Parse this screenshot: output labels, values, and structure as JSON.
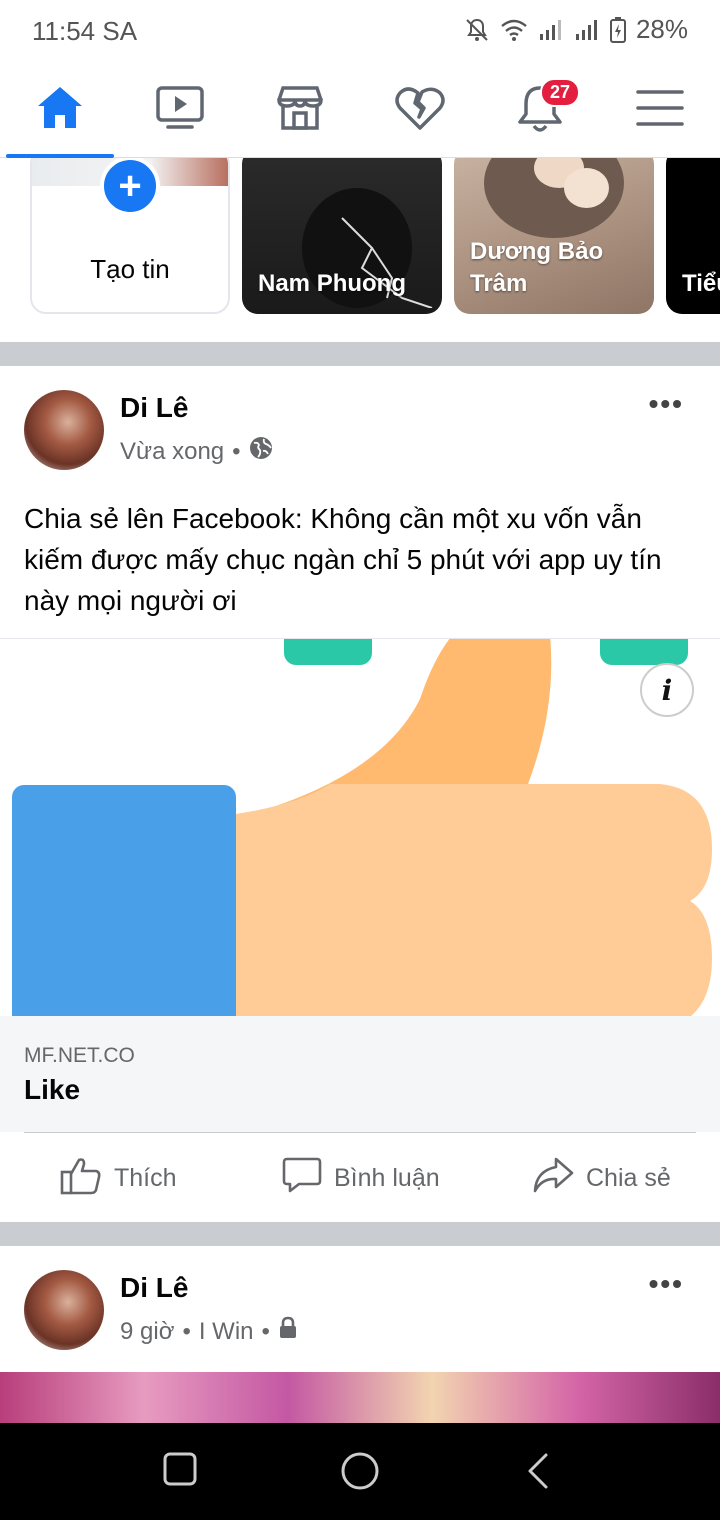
{
  "status_bar": {
    "time": "11:54 SA",
    "battery": "28%"
  },
  "nav": {
    "tabs": [
      "home-icon",
      "watch-icon",
      "marketplace-icon",
      "dating-icon",
      "notifications-icon",
      "menu-icon"
    ],
    "active": "home-icon",
    "notification_count": "27",
    "accent_color": "#1877f2",
    "badge_color": "#e41e3f"
  },
  "stories": {
    "create_label": "Tạo tin",
    "items": [
      {
        "name": "Nam Phuong"
      },
      {
        "name": "Dương Bảo\nTrâm",
        "line1": "Dương Bảo",
        "line2": "Trâm"
      },
      {
        "name": "Tiểu"
      }
    ]
  },
  "post": {
    "author": "Di Lê",
    "time": "Vừa xong",
    "privacy_icon": "globe-icon",
    "text": "Chia sẻ lên Facebook: Không cần một xu vốn vẫn kiếm được mấy chục ngàn chỉ 5 phút với app uy tín này mọi người ơi",
    "link": {
      "domain": "MF.NET.CO",
      "title": "Like"
    },
    "actions": {
      "like": "Thích",
      "comment": "Bình luận",
      "share": "Chia sẻ"
    }
  },
  "post2": {
    "author": "Di Lê",
    "meta_time": "9 giờ",
    "meta_app": "I Win",
    "privacy_icon": "lock-icon"
  },
  "system_nav": [
    "recents-icon",
    "home-circle-icon",
    "back-icon"
  ]
}
